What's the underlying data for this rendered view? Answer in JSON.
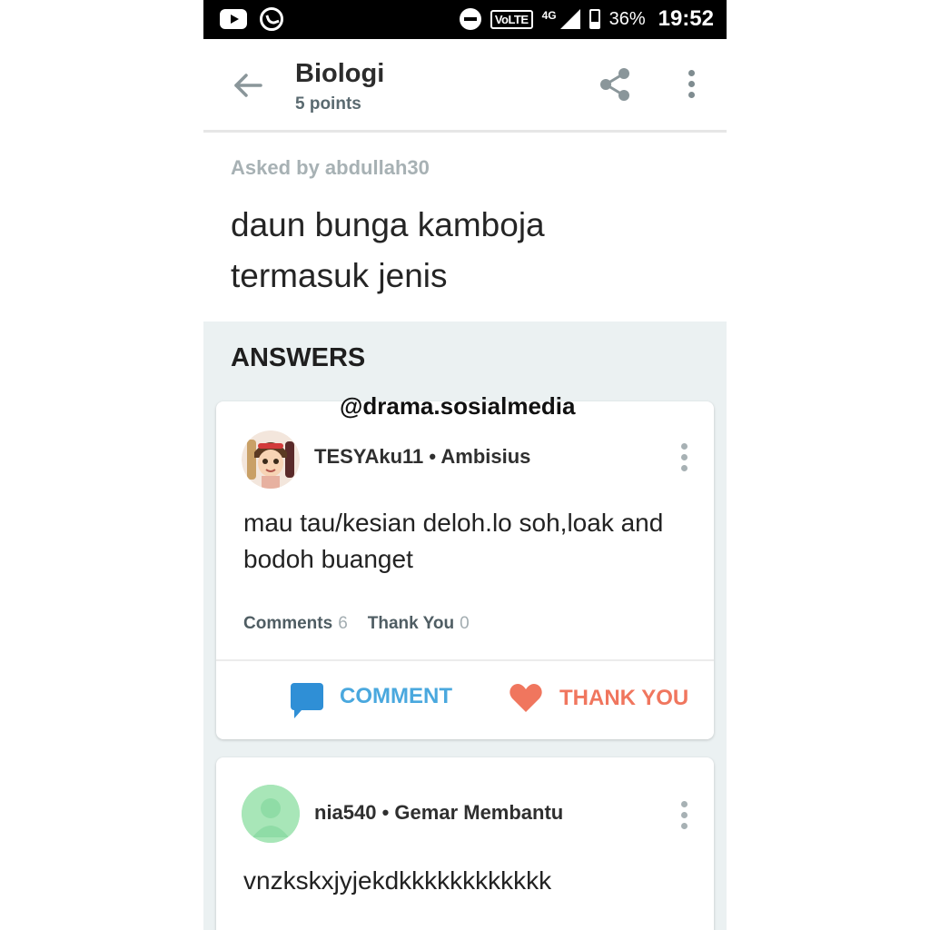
{
  "status_bar": {
    "network_label": "4G",
    "lte_label": "VoLTE",
    "battery": "36%",
    "time": "19:52"
  },
  "header": {
    "title": "Biologi",
    "points": "5 points"
  },
  "question": {
    "asked_by": "Asked by abdullah30",
    "text": "daun bunga kamboja termasuk jenis"
  },
  "answers": {
    "section_title": "ANSWERS",
    "watermark": "@drama.sosialmedia",
    "items": [
      {
        "user": "TESYAku11 • Ambisius",
        "body": "mau tau/kesian deloh.lo soh,loak and bodoh buanget",
        "comments_label": "Comments",
        "comments_count": "6",
        "thanks_label": "Thank You",
        "thanks_count": "0",
        "comment_button": "COMMENT",
        "thank_button": "THANK YOU"
      },
      {
        "user": "nia540 • Gemar Membantu",
        "body": "vnzkskxjyjekdkkkkkkkkkkkk"
      }
    ]
  },
  "colors": {
    "comment_accent": "#4aa8de",
    "thank_accent": "#f0765e",
    "answers_bg": "#ebf1f2"
  }
}
